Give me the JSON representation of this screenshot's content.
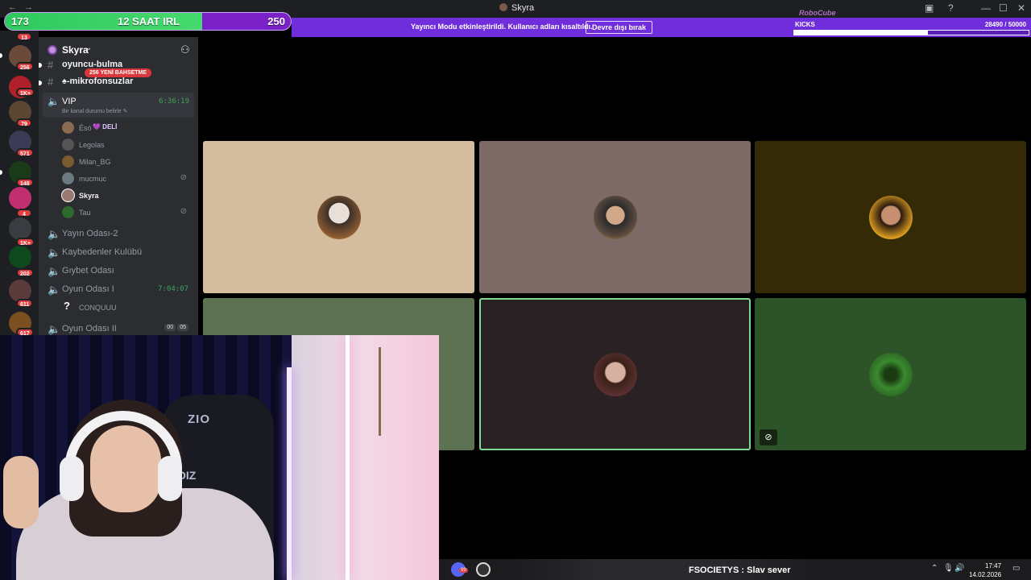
{
  "window": {
    "title": "Skyra"
  },
  "overlay": {
    "irl_left": "173",
    "irl_center": "12 SAAT IRL",
    "irl_right": "250",
    "irl_progress": 0.69,
    "notice_text": "Yayıncı Modu etkinleştirildi. Kullanıcı adları kısaltıldı.",
    "notice_button": "Devre dışı bırak",
    "kicks_label": "KICKS",
    "kicks_value": "28490",
    "kicks_goal": "/ 50000",
    "kicks_progress": 0.57
  },
  "rail": {
    "badges": [
      "13",
      "256",
      "1K+",
      "79",
      "571",
      "148",
      "4",
      "1K+",
      "202",
      "611",
      "617"
    ]
  },
  "sidebar": {
    "server_name": "Skyra",
    "mention_pill": "256 YENİ BAHSETME",
    "channels": {
      "text1": "oyuncu-bulma",
      "text2": "♠-mikrofonsuzlar",
      "vip_name": "VIP",
      "vip_status": "Bir kanal durumu belirle",
      "vip_time": "6:36:19",
      "v2": "Yayın Odası-2",
      "v3": "Kaybedenler Kulübü",
      "v4": "Gıybet Odası",
      "v5": "Oyun Odası I",
      "v5_time": "7:04:07",
      "v6": "Oyun Odası II",
      "v6_a": "00",
      "v6_b": "05"
    },
    "members": [
      {
        "name": "Ésó",
        "tag": "💜 DELİ"
      },
      {
        "name": "Legolas"
      },
      {
        "name": "Milan_BG"
      },
      {
        "name": "mucmuc"
      },
      {
        "name": "Skyra"
      },
      {
        "name": "Tau"
      }
    ],
    "oyun_member": "CONQUUU"
  },
  "taskbar": {
    "ticker": "FSOCIETYS : Slav sever",
    "time": "17:47",
    "date": "14.02.2026",
    "badge": "99"
  }
}
